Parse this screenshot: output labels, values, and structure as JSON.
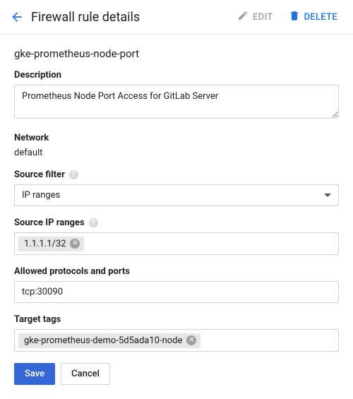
{
  "header": {
    "title": "Firewall rule details",
    "edit_label": "EDIT",
    "delete_label": "DELETE"
  },
  "rule": {
    "name": "gke-prometheus-node-port"
  },
  "labels": {
    "description": "Description",
    "network": "Network",
    "source_filter": "Source filter",
    "source_ip_ranges": "Source IP ranges",
    "allowed_protocols": "Allowed protocols and ports",
    "target_tags": "Target tags"
  },
  "values": {
    "description": "Prometheus Node Port Access for GitLab Server",
    "network": "default",
    "source_filter_selected": "IP ranges",
    "source_ip_chip": "1.1.1.1/32",
    "allowed_protocols": "tcp:30090",
    "target_tag_chip": "gke-prometheus-demo-5d5ada10-node"
  },
  "actions": {
    "save": "Save",
    "cancel": "Cancel"
  }
}
